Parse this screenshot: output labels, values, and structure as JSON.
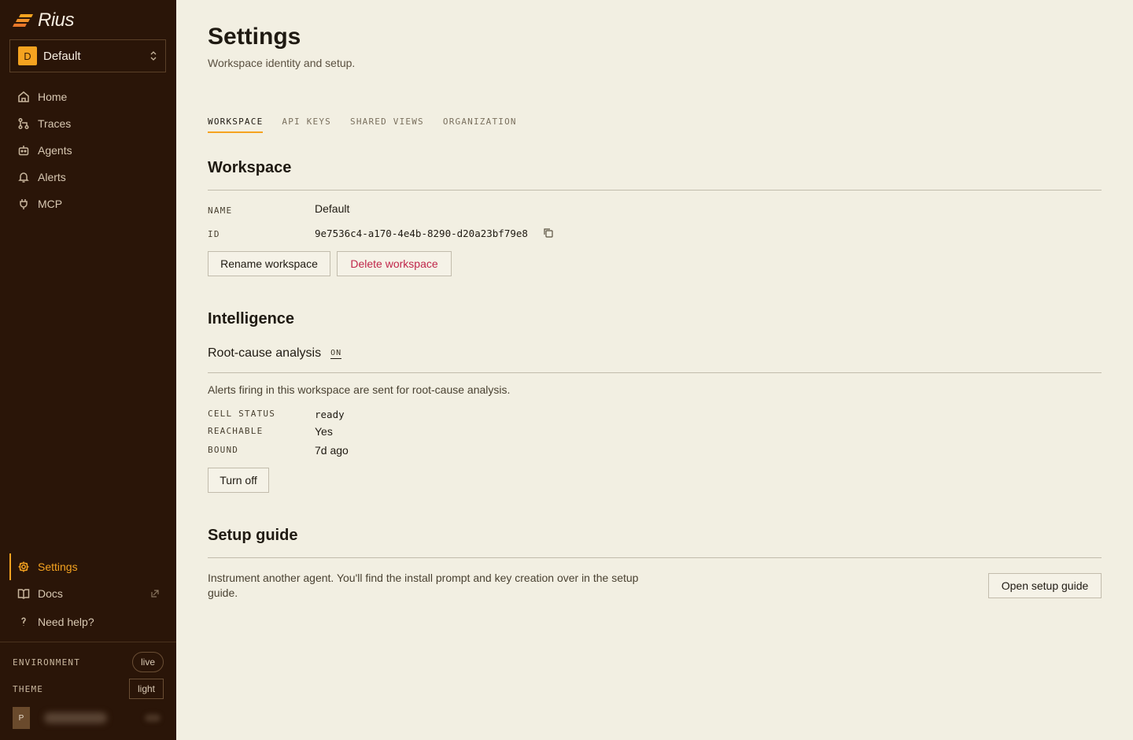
{
  "brand": {
    "name": "Rius",
    "accent": "#f5a320"
  },
  "workspace_switcher": {
    "avatar": "D",
    "name": "Default"
  },
  "nav": {
    "items": [
      {
        "label": "Home",
        "icon": "home-icon"
      },
      {
        "label": "Traces",
        "icon": "traces-icon"
      },
      {
        "label": "Agents",
        "icon": "bot-icon"
      },
      {
        "label": "Alerts",
        "icon": "bell-icon"
      },
      {
        "label": "MCP",
        "icon": "plug-icon"
      }
    ],
    "bottom": [
      {
        "label": "Settings",
        "icon": "gear-icon",
        "active": true
      },
      {
        "label": "Docs",
        "icon": "book-icon"
      },
      {
        "label": "Need help?",
        "icon": "question-icon"
      }
    ]
  },
  "footer": {
    "environment_label": "ENVIRONMENT",
    "environment_value": "live",
    "theme_label": "THEME",
    "theme_value": "light",
    "user_avatar": "P"
  },
  "page": {
    "title": "Settings",
    "subtitle": "Workspace identity and setup."
  },
  "tabs": [
    {
      "label": "WORKSPACE",
      "active": true
    },
    {
      "label": "API KEYS"
    },
    {
      "label": "SHARED VIEWS"
    },
    {
      "label": "ORGANIZATION"
    }
  ],
  "workspace_section": {
    "heading": "Workspace",
    "name_label": "NAME",
    "name_value": "Default",
    "id_label": "ID",
    "id_value": "9e7536c4-a170-4e4b-8290-d20a23bf79e8",
    "rename_label": "Rename workspace",
    "delete_label": "Delete workspace"
  },
  "intelligence": {
    "heading": "Intelligence",
    "rca_title": "Root-cause analysis",
    "rca_badge": "ON",
    "description": "Alerts firing in this workspace are sent for root-cause analysis.",
    "cell_status_label": "CELL STATUS",
    "cell_status_value": "ready",
    "reachable_label": "REACHABLE",
    "reachable_value": "Yes",
    "bound_label": "BOUND",
    "bound_value": "7d ago",
    "turn_off_label": "Turn off"
  },
  "setup_guide": {
    "heading": "Setup guide",
    "text": "Instrument another agent. You'll find the install prompt and key creation over in the setup guide.",
    "button_label": "Open setup guide"
  }
}
